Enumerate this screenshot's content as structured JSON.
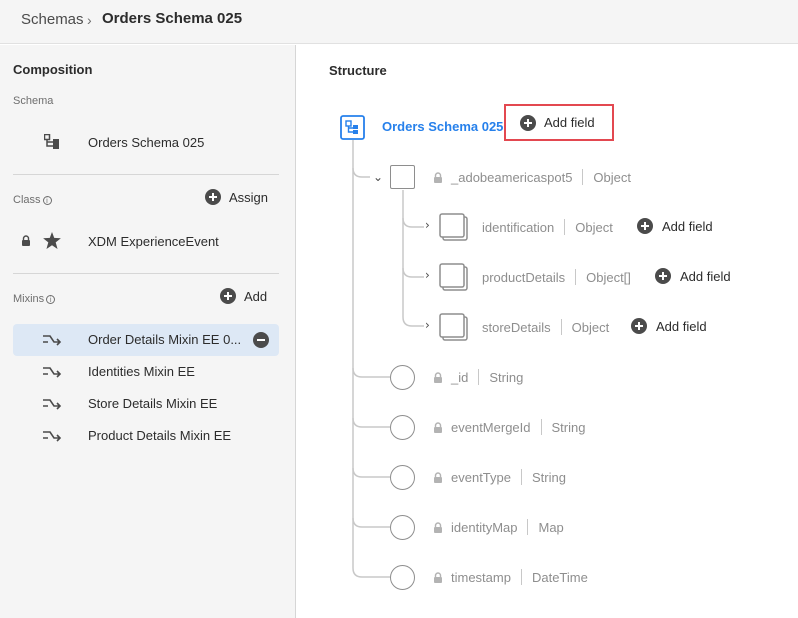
{
  "breadcrumb": {
    "root": "Schemas",
    "separator": "›",
    "current": "Orders Schema 025"
  },
  "composition": {
    "title": "Composition",
    "schema_label": "Schema",
    "schema_name": "Orders Schema 025",
    "class_label": "Class",
    "class_action": "Assign",
    "class_name": "XDM ExperienceEvent",
    "mixins_label": "Mixins",
    "mixins_action": "Add",
    "mixins": [
      {
        "label": "Order Details Mixin EE 0...",
        "selected": true
      },
      {
        "label": "Identities Mixin EE",
        "selected": false
      },
      {
        "label": "Store Details Mixin EE",
        "selected": false
      },
      {
        "label": "Product Details Mixin EE",
        "selected": false
      }
    ]
  },
  "structure": {
    "title": "Structure",
    "root_name": "Orders Schema 025",
    "add_field_label": "Add field",
    "object_field": {
      "name": "_adobeamericaspot5",
      "type": "Object"
    },
    "sub_fields": [
      {
        "name": "identification",
        "type": "Object",
        "action": "Add field"
      },
      {
        "name": "productDetails",
        "type": "Object[]",
        "action": "Add field"
      },
      {
        "name": "storeDetails",
        "type": "Object",
        "action": "Add field"
      }
    ],
    "fields": [
      {
        "name": "_id",
        "type": "String"
      },
      {
        "name": "eventMergeId",
        "type": "String"
      },
      {
        "name": "eventType",
        "type": "String"
      },
      {
        "name": "identityMap",
        "type": "Map"
      },
      {
        "name": "timestamp",
        "type": "DateTime"
      }
    ]
  },
  "colors": {
    "accent": "#2680eb",
    "highlight_border": "#e34850",
    "selected_row": "#dde8f5"
  }
}
